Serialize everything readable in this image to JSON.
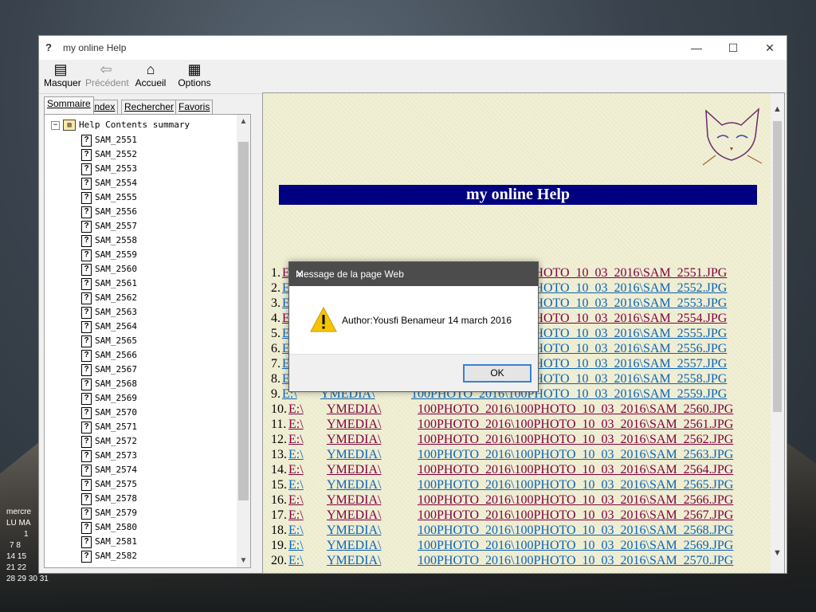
{
  "window": {
    "title": "my online Help",
    "minimize": "—",
    "maximize": "☐",
    "close": "✕"
  },
  "toolbar": {
    "hide": "Masquer",
    "back": "Précédent",
    "home": "Accueil",
    "options": "Options"
  },
  "tabs": [
    "Sommaire",
    "Index",
    "Rechercher",
    "Favoris"
  ],
  "tree": {
    "root": "Help Contents summary",
    "items": [
      "SAM_2551",
      "SAM_2552",
      "SAM_2553",
      "SAM_2554",
      "SAM_2555",
      "SAM_2556",
      "SAM_2557",
      "SAM_2558",
      "SAM_2559",
      "SAM_2560",
      "SAM_2561",
      "SAM_2562",
      "SAM_2563",
      "SAM_2564",
      "SAM_2565",
      "SAM_2566",
      "SAM_2567",
      "SAM_2568",
      "SAM_2569",
      "SAM_2570",
      "SAM_2571",
      "SAM_2572",
      "SAM_2573",
      "SAM_2574",
      "SAM_2575",
      "SAM_2578",
      "SAM_2579",
      "SAM_2580",
      "SAM_2581",
      "SAM_2582"
    ]
  },
  "content": {
    "banner": "my online Help",
    "lines": [
      {
        "n": "1.",
        "drive": "E:\\",
        "media": "YMEDIA\\",
        "path": "100PHOTO_2016\\100PHOTO_10_03_2016\\SAM_2551.JPG",
        "visited": true
      },
      {
        "n": "2.",
        "drive": "E:\\",
        "media": "YMEDIA\\",
        "path": "100PHOTO_2016\\100PHOTO_10_03_2016\\SAM_2552.JPG",
        "visited": false
      },
      {
        "n": "3.",
        "drive": "E:\\",
        "media": "YMEDIA\\",
        "path": "100PHOTO_2016\\100PHOTO_10_03_2016\\SAM_2553.JPG",
        "visited": false
      },
      {
        "n": "4.",
        "drive": "E:\\",
        "media": "YMEDIA\\",
        "path": "100PHOTO_2016\\100PHOTO_10_03_2016\\SAM_2554.JPG",
        "visited": true
      },
      {
        "n": "5.",
        "drive": "E:\\",
        "media": "YMEDIA\\",
        "path": "100PHOTO_2016\\100PHOTO_10_03_2016\\SAM_2555.JPG",
        "visited": false
      },
      {
        "n": "6.",
        "drive": "E:\\",
        "media": "YMEDIA\\",
        "path": "100PHOTO_2016\\100PHOTO_10_03_2016\\SAM_2556.JPG",
        "visited": false
      },
      {
        "n": "7.",
        "drive": "E:\\",
        "media": "YMEDIA\\",
        "path": "100PHOTO_2016\\100PHOTO_10_03_2016\\SAM_2557.JPG",
        "visited": false
      },
      {
        "n": "8.",
        "drive": "E:\\",
        "media": "YMEDIA\\",
        "path": "100PHOTO_2016\\100PHOTO_10_03_2016\\SAM_2558.JPG",
        "visited": false
      },
      {
        "n": "9.",
        "drive": "E:\\",
        "media": "YMEDIA\\",
        "path": "100PHOTO_2016\\100PHOTO_10_03_2016\\SAM_2559.JPG",
        "visited": false
      },
      {
        "n": "10.",
        "drive": "E:\\",
        "media": "YMEDIA\\",
        "path": "100PHOTO_2016\\100PHOTO_10_03_2016\\SAM_2560.JPG",
        "visited": true
      },
      {
        "n": "11.",
        "drive": "E:\\",
        "media": "YMEDIA\\",
        "path": "100PHOTO_2016\\100PHOTO_10_03_2016\\SAM_2561.JPG",
        "visited": true
      },
      {
        "n": "12.",
        "drive": "E:\\",
        "media": "YMEDIA\\",
        "path": "100PHOTO_2016\\100PHOTO_10_03_2016\\SAM_2562.JPG",
        "visited": true
      },
      {
        "n": "13.",
        "drive": "E:\\",
        "media": "YMEDIA\\",
        "path": "100PHOTO_2016\\100PHOTO_10_03_2016\\SAM_2563.JPG",
        "visited": false
      },
      {
        "n": "14.",
        "drive": "E:\\",
        "media": "YMEDIA\\",
        "path": "100PHOTO_2016\\100PHOTO_10_03_2016\\SAM_2564.JPG",
        "visited": true
      },
      {
        "n": "15.",
        "drive": "E:\\",
        "media": "YMEDIA\\",
        "path": "100PHOTO_2016\\100PHOTO_10_03_2016\\SAM_2565.JPG",
        "visited": false
      },
      {
        "n": "16.",
        "drive": "E:\\",
        "media": "YMEDIA\\",
        "path": "100PHOTO_2016\\100PHOTO_10_03_2016\\SAM_2566.JPG",
        "visited": true
      },
      {
        "n": "17.",
        "drive": "E:\\",
        "media": "YMEDIA\\",
        "path": "100PHOTO_2016\\100PHOTO_10_03_2016\\SAM_2567.JPG",
        "visited": true
      },
      {
        "n": "18.",
        "drive": "E:\\",
        "media": "YMEDIA\\",
        "path": "100PHOTO_2016\\100PHOTO_10_03_2016\\SAM_2568.JPG",
        "visited": false
      },
      {
        "n": "19.",
        "drive": "E:\\",
        "media": "YMEDIA\\",
        "path": "100PHOTO_2016\\100PHOTO_10_03_2016\\SAM_2569.JPG",
        "visited": false
      },
      {
        "n": "20.",
        "drive": "E:\\",
        "media": "YMEDIA\\",
        "path": "100PHOTO_2016\\100PHOTO_10_03_2016\\SAM_2570.JPG",
        "visited": false
      }
    ]
  },
  "dialog": {
    "title": "Message de la page Web",
    "close": "✕",
    "message": "Author:Yousfi Benameur  14 march 2016",
    "ok": "OK"
  },
  "desktop_calendar": {
    "month": "mercre",
    "days_header": "LU MA",
    "rows": [
      "1",
      "7  8",
      "14 15",
      "21 22",
      "28 29 30 31"
    ]
  },
  "colors": {
    "banner_bg": "#000080",
    "link": "#0b63b5",
    "visited": "#800040",
    "dialog_title_bg": "#4c4c4c",
    "ok_border": "#3c7fd1"
  },
  "icons": {
    "app": "help-book-icon",
    "hide": "hide-pane-icon",
    "back": "back-arrow-icon",
    "home": "house-icon",
    "options": "options-icon",
    "warning": "warning-triangle-icon"
  }
}
